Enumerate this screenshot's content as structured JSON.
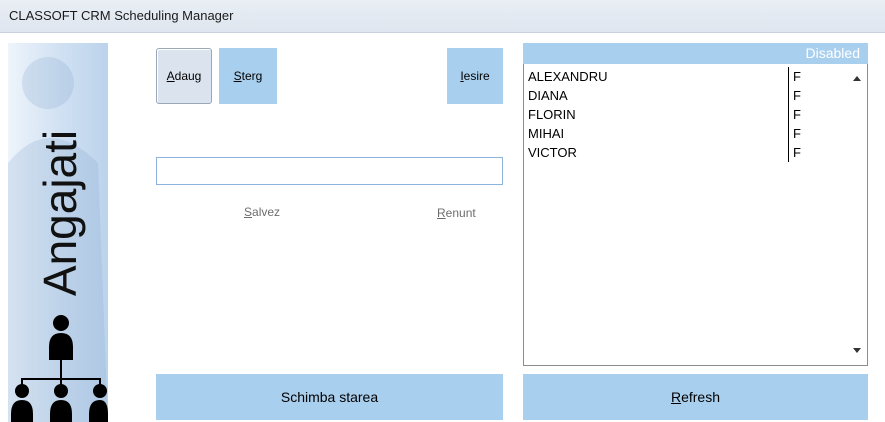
{
  "window": {
    "title": "CLASSOFT CRM Scheduling Manager"
  },
  "sidebar": {
    "title": "Angajati",
    "icon": "org-chart-icon"
  },
  "toolbar": {
    "add_label": "Adaug",
    "add_accel": "A",
    "add_rest": "daug",
    "delete_label": "Sterg",
    "delete_accel": "S",
    "delete_rest": "terg",
    "exit_label": "Iesire",
    "exit_accel": "I",
    "exit_rest": "esire"
  },
  "form": {
    "name_value": "",
    "save_label": "Salvez",
    "save_accel": "S",
    "save_rest": "alvez",
    "cancel_label": "Renunt",
    "cancel_accel": "R",
    "cancel_rest": "enunt"
  },
  "list": {
    "status": "Disabled",
    "rows": [
      {
        "name": "ALEXANDRU",
        "value": "F"
      },
      {
        "name": "DIANA",
        "value": "F"
      },
      {
        "name": "FLORIN",
        "value": "F"
      },
      {
        "name": "MIHAI",
        "value": "F"
      },
      {
        "name": "VICTOR",
        "value": "F"
      }
    ]
  },
  "footer": {
    "change_state_label": "Schimba starea",
    "refresh_label": "Refresh",
    "refresh_accel": "R",
    "refresh_rest": "efresh"
  },
  "colors": {
    "accent": "#a9cfee",
    "sidebar": "#cfe0f2",
    "textbox_border": "#8db2dd"
  }
}
